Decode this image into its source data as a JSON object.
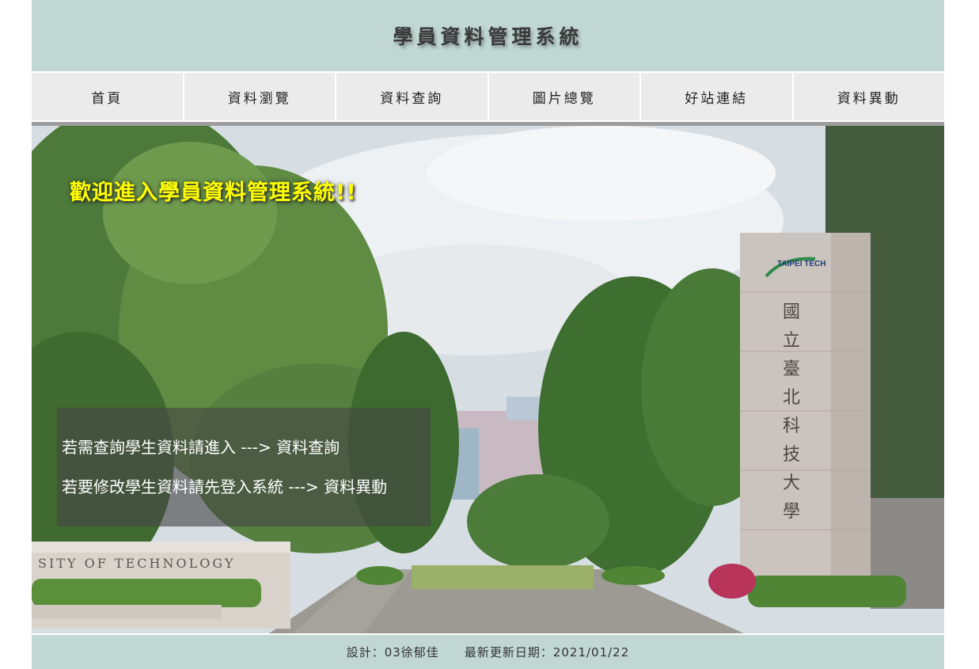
{
  "header": {
    "title": "學員資料管理系統"
  },
  "nav": {
    "items": [
      {
        "label": "首頁"
      },
      {
        "label": "資料瀏覽"
      },
      {
        "label": "資料查詢"
      },
      {
        "label": "圖片總覽"
      },
      {
        "label": "好站連結"
      },
      {
        "label": "資料異動"
      }
    ]
  },
  "hero": {
    "welcome": "歡迎進入學員資料管理系統!!",
    "line1": "若需查詢學生資料請進入 ---> 資料查詢",
    "line2": "若要修改學生資料請先登入系統 ---> 資料異動",
    "wall_text": "SITY OF TECHNOLOGY",
    "logo_text": "TAIPEI TECH",
    "pillar_chars": [
      "國",
      "立",
      "臺",
      "北",
      "科",
      "技",
      "大",
      "學"
    ]
  },
  "footer": {
    "designer": "設計：03徐郁佳",
    "updated": "最新更新日期：2021/01/22"
  },
  "colors": {
    "header_bg": "#c1d8d2",
    "nav_bg": "#ebebeb",
    "welcome": "#ffff00"
  }
}
